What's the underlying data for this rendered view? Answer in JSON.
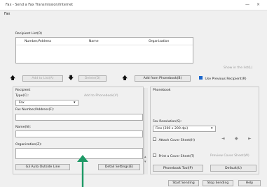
{
  "window": {
    "title": "Fax - Send a Fax Transmission/Internet",
    "minimize": "—",
    "close": "×"
  },
  "menu": {
    "file": "Fax"
  },
  "recipients": {
    "label": "Recipient List(O)",
    "columns": [
      "Number/Address",
      "Name",
      "Organization"
    ],
    "show_in_list": "Show in the list(L)"
  },
  "list_toolbar": {
    "add_entry": "Add to List(A)",
    "delete": "Delete(D)",
    "add_from_phonebook": "Add from Phonebook(B)",
    "use_previous": "Use Previous Recipient(R)",
    "use_previous_checked": true
  },
  "recipient": {
    "section": "Recipient",
    "type_label": "Type(C):",
    "type_value": "Fax",
    "register_link": "Add to Phonebook(V)",
    "number_label": "Fax Number/Address(F):",
    "name_label": "Name(N):",
    "org_label": "Organization(Z):",
    "auto_line": "G3 Auto Outside Line",
    "detail_settings": "Detail Settings(E)"
  },
  "coversheet": {
    "section": "Phonebook",
    "resolution_label": "Fax Resolution(S):",
    "resolution_value": "Fine (200 x 200 dpi)",
    "attach_label": "Attach Cover Sheet(H)",
    "attach_checked": false,
    "print_label": "Print a Cover Sheet(T)",
    "print_checked": false,
    "preview": "Preview Cover Sheet(W)",
    "fax_settings": "Phonebook Tool(P)",
    "default": "Default(U)"
  },
  "footer": {
    "start": "Start Sending",
    "stop": "Stop Sending",
    "help": "Help"
  },
  "colors": {
    "annotation_arrow": "#1e9966",
    "check_on": "#1a66cc"
  }
}
